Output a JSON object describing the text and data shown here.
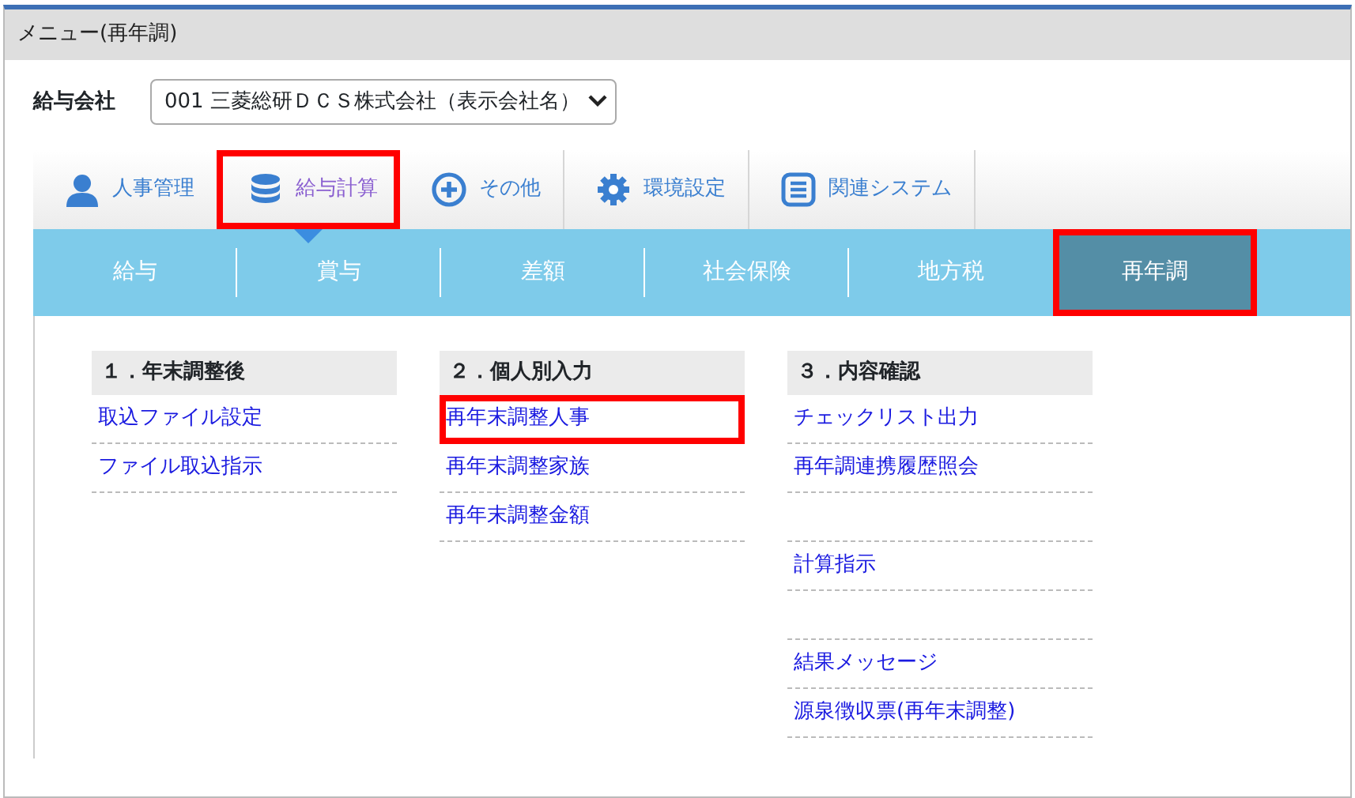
{
  "window": {
    "title": "メニュー(再年調)"
  },
  "company": {
    "label": "給与会社",
    "value": "001 三菱総研ＤＣＳ株式会社（表示会社名）"
  },
  "top_nav": [
    {
      "label": "人事管理",
      "selected": false,
      "highlighted": false
    },
    {
      "label": "給与計算",
      "selected": true,
      "highlighted": true
    },
    {
      "label": "その他",
      "selected": false,
      "highlighted": false
    },
    {
      "label": "環境設定",
      "selected": false,
      "highlighted": false
    },
    {
      "label": "関連システム",
      "selected": false,
      "highlighted": false
    }
  ],
  "sub_tabs": [
    {
      "label": "給与",
      "selected": false,
      "highlighted": false
    },
    {
      "label": "賞与",
      "selected": false,
      "highlighted": false
    },
    {
      "label": "差額",
      "selected": false,
      "highlighted": false
    },
    {
      "label": "社会保険",
      "selected": false,
      "highlighted": false
    },
    {
      "label": "地方税",
      "selected": false,
      "highlighted": false
    },
    {
      "label": "再年調",
      "selected": true,
      "highlighted": true
    }
  ],
  "sections": [
    {
      "title": "１．年末調整後",
      "items": [
        {
          "kind": "link",
          "label": "取込ファイル設定",
          "highlighted": false
        },
        {
          "kind": "link",
          "label": "ファイル取込指示",
          "highlighted": false
        }
      ]
    },
    {
      "title": "２．個人別入力",
      "items": [
        {
          "kind": "link",
          "label": "再年末調整人事",
          "highlighted": true
        },
        {
          "kind": "link",
          "label": "再年末調整家族",
          "highlighted": false
        },
        {
          "kind": "link",
          "label": "再年末調整金額",
          "highlighted": false
        }
      ]
    },
    {
      "title": "３．内容確認",
      "items": [
        {
          "kind": "link",
          "label": "チェックリスト出力",
          "highlighted": false
        },
        {
          "kind": "link",
          "label": "再年調連携履歴照会",
          "highlighted": false
        },
        {
          "kind": "blank"
        },
        {
          "kind": "link",
          "label": "計算指示",
          "highlighted": false
        },
        {
          "kind": "blank"
        },
        {
          "kind": "link",
          "label": "結果メッセージ",
          "highlighted": false
        },
        {
          "kind": "link",
          "label": "源泉徴収票(再年末調整)",
          "highlighted": false
        }
      ]
    }
  ]
}
